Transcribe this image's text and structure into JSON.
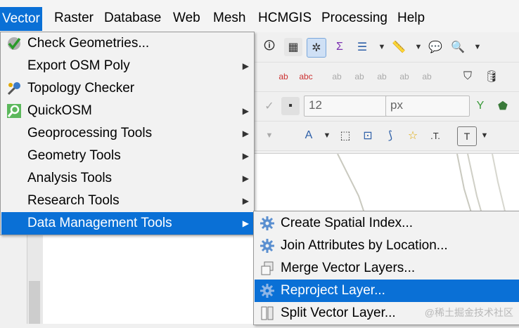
{
  "menubar": {
    "items": [
      {
        "label": "Vector",
        "active": true
      },
      {
        "label": "Raster"
      },
      {
        "label": "Database"
      },
      {
        "label": "Web"
      },
      {
        "label": "Mesh"
      },
      {
        "label": "HCMGIS"
      },
      {
        "label": "Processing"
      },
      {
        "label": "Help"
      }
    ]
  },
  "vector_menu": {
    "items": [
      {
        "label": "Check Geometries...",
        "icon": "check-geometries-icon"
      },
      {
        "label": "Export OSM Poly",
        "has_submenu": true
      },
      {
        "label": "Topology Checker",
        "icon": "topology-checker-icon"
      },
      {
        "label": "QuickOSM",
        "icon": "quickosm-icon",
        "has_submenu": true
      },
      {
        "label": "Geoprocessing Tools",
        "has_submenu": true
      },
      {
        "label": "Geometry Tools",
        "has_submenu": true
      },
      {
        "label": "Analysis Tools",
        "has_submenu": true
      },
      {
        "label": "Research Tools",
        "has_submenu": true
      },
      {
        "label": "Data Management Tools",
        "has_submenu": true,
        "highlighted": true
      }
    ]
  },
  "data_management_submenu": {
    "items": [
      {
        "label": "Create Spatial Index...",
        "icon": "gear-icon"
      },
      {
        "label": "Join Attributes by Location...",
        "icon": "gear-icon"
      },
      {
        "label": "Merge Vector Layers...",
        "icon": "merge-layers-icon"
      },
      {
        "label": "Reproject Layer...",
        "icon": "gear-icon",
        "highlighted": true
      },
      {
        "label": "Split Vector Layer...",
        "icon": "split-layer-icon"
      }
    ]
  },
  "toolbar": {
    "font_size_value": "12",
    "unit_value": "px"
  },
  "watermark": "@稀土掘金技术社区",
  "colors": {
    "highlight": "#0a70d6",
    "menu_bg": "#f2f2f2"
  }
}
